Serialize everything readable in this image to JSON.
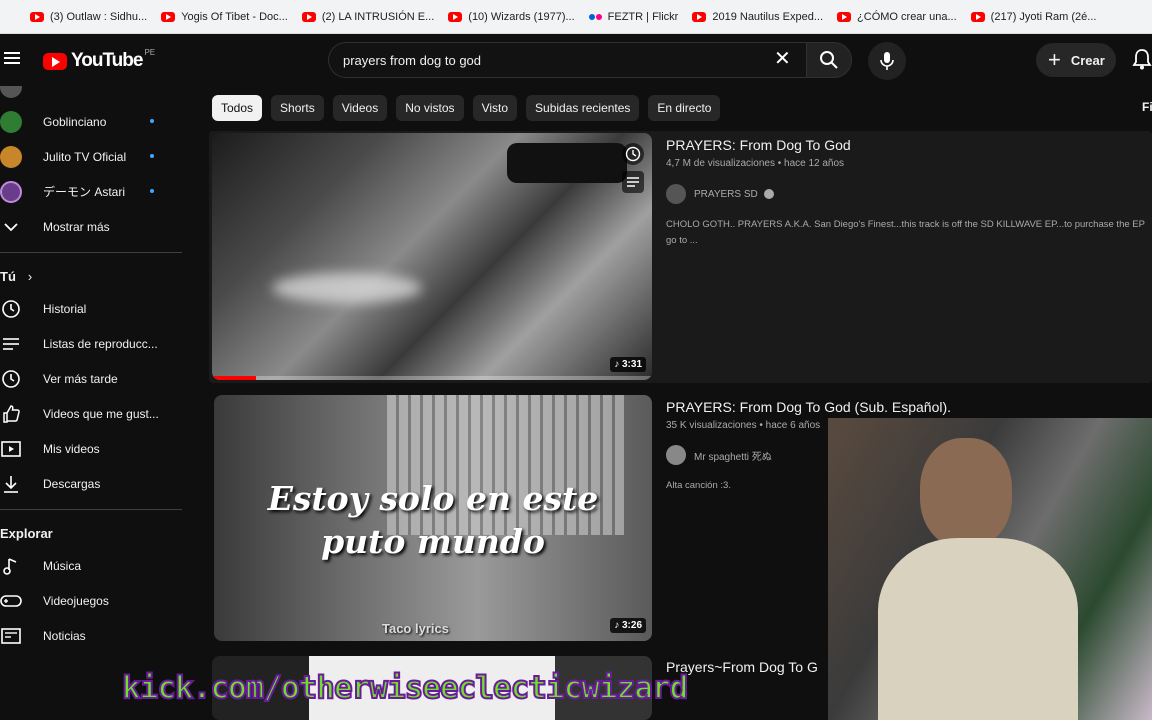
{
  "bookmarks": [
    {
      "label": "(3) Outlaw : Sidhu...",
      "icon": "youtube-icon"
    },
    {
      "label": "Yogis Of Tibet - Doc...",
      "icon": "youtube-icon"
    },
    {
      "label": "(2) LA INTRUSIÓN E...",
      "icon": "youtube-icon"
    },
    {
      "label": "(10) Wizards (1977)...",
      "icon": "youtube-icon"
    },
    {
      "label": "FEZTR | Flickr",
      "icon": "flickr-icon"
    },
    {
      "label": "2019 Nautilus Exped...",
      "icon": "youtube-icon"
    },
    {
      "label": "¿CÓMO crear una...",
      "icon": "youtube-icon"
    },
    {
      "label": "(217) Jyoti Ram (2é...",
      "icon": "youtube-icon"
    }
  ],
  "header": {
    "logo_text": "YouTube",
    "country_code": "PE",
    "search_value": "prayers from dog to god",
    "create_label": "Crear"
  },
  "sidebar": {
    "subscriptions": [
      {
        "label": "Goblinciano",
        "avatar_color": "#2f7d32"
      },
      {
        "label": "Julito TV Oficial",
        "avatar_color": "#c8862a"
      },
      {
        "label": "デーモン Astari",
        "avatar_color": "#6a3c8c"
      }
    ],
    "show_more": "Mostrar más",
    "you_heading": "Tú",
    "you_items": [
      {
        "label": "Historial",
        "icon": "history-icon"
      },
      {
        "label": "Listas de reproducc...",
        "icon": "playlists-icon"
      },
      {
        "label": "Ver más tarde",
        "icon": "watch-later-icon"
      },
      {
        "label": "Videos que me gust...",
        "icon": "liked-icon"
      },
      {
        "label": "Mis videos",
        "icon": "your-videos-icon"
      },
      {
        "label": "Descargas",
        "icon": "downloads-icon"
      }
    ],
    "explore_heading": "Explorar",
    "explore_items": [
      {
        "label": "Música",
        "icon": "music-icon"
      },
      {
        "label": "Videojuegos",
        "icon": "gaming-icon"
      },
      {
        "label": "Noticias",
        "icon": "news-icon"
      }
    ]
  },
  "chips": [
    "Todos",
    "Shorts",
    "Videos",
    "No vistos",
    "Visto",
    "Subidas recientes",
    "En directo"
  ],
  "chip_edge": "Fi",
  "results": [
    {
      "title": "PRAYERS: From Dog To God",
      "meta": "4,7 M de visualizaciones • hace 12 años",
      "channel": "PRAYERS SD",
      "description": "CHOLO GOTH.. PRAYERS A.K.A. San Diego's Finest...this track is off the SD KILLWAVE EP...to purchase the EP go to ...",
      "duration": "3:31",
      "watched_fraction": 0.1
    },
    {
      "title": "PRAYERS: From Dog To God (Sub. Español).",
      "meta": "35 K visualizaciones • hace 6 años",
      "channel": "Mr spaghetti 死ぬ",
      "description": "Alta canción :3.",
      "duration": "3:26",
      "thumb_caption": "Estoy solo en este puto mundo",
      "thumb_watermark": "Taco lyrics"
    },
    {
      "title": "Prayers~From Dog To G"
    }
  ],
  "overlay_banner": "kick.com/otherwiseeclecticwizard"
}
